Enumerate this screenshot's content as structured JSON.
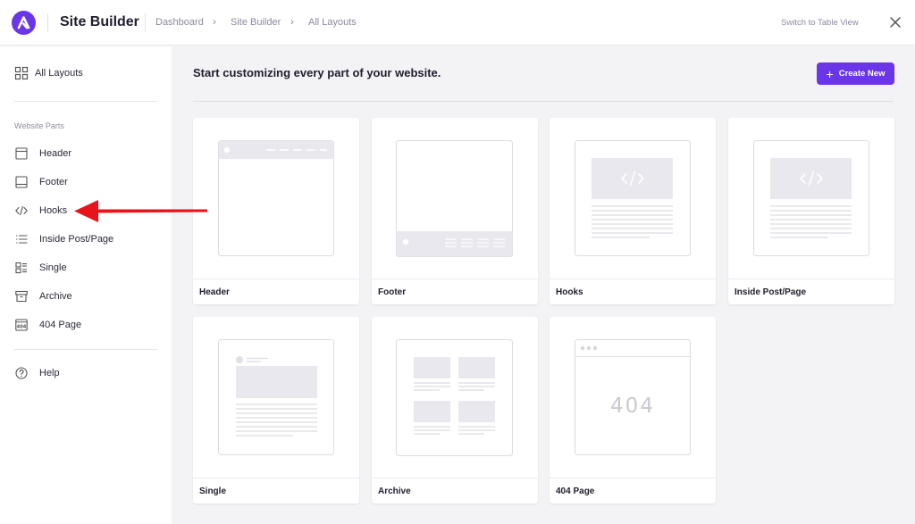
{
  "header": {
    "app_title": "Site Builder",
    "breadcrumbs": [
      "Dashboard",
      "Site Builder",
      "All Layouts"
    ],
    "switch_view_label": "Switch to Table View"
  },
  "sidebar": {
    "all_layouts_label": "All Layouts",
    "section_heading": "Website Parts",
    "items": [
      {
        "label": "Header",
        "icon": "header-icon"
      },
      {
        "label": "Footer",
        "icon": "footer-icon"
      },
      {
        "label": "Hooks",
        "icon": "code-icon"
      },
      {
        "label": "Inside Post/Page",
        "icon": "list-icon"
      },
      {
        "label": "Single",
        "icon": "single-icon"
      },
      {
        "label": "Archive",
        "icon": "archive-icon"
      },
      {
        "label": "404 Page",
        "icon": "404-icon"
      }
    ],
    "help_label": "Help"
  },
  "main": {
    "title": "Start customizing every part of your website.",
    "create_button_label": "Create New",
    "cards": [
      {
        "label": "Header"
      },
      {
        "label": "Footer"
      },
      {
        "label": "Hooks"
      },
      {
        "label": "Inside Post/Page"
      },
      {
        "label": "Single"
      },
      {
        "label": "Archive"
      },
      {
        "label": "404 Page",
        "preview_text": "404"
      }
    ]
  },
  "colors": {
    "accent": "#6b35e8",
    "annotation_arrow": "#e8141c"
  }
}
